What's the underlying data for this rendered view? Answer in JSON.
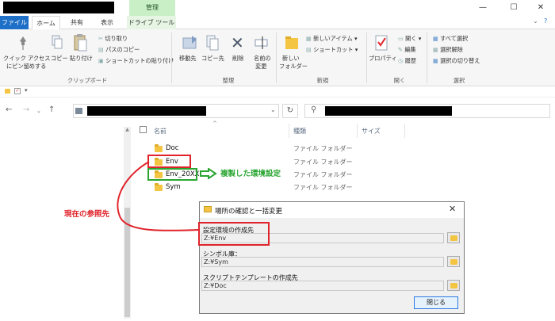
{
  "window": {
    "manage_tab": "管理",
    "minimize": "—",
    "maximize": "☐",
    "close": "✕"
  },
  "tabs": [
    "ファイル",
    "ホーム",
    "共有",
    "表示",
    "ドライブ ツール"
  ],
  "ribbon": {
    "pin_label_1": "クイック アクセス",
    "pin_label_2": "にピン留めする",
    "copy": "コピー",
    "paste": "貼り付け",
    "cut": "切り取り",
    "copy_path": "パスのコピー",
    "paste_shortcut": "ショートカットの貼り付け",
    "clipboard_group": "クリップボード",
    "move_to": "移動先",
    "copy_to": "コピー先",
    "delete": "削除",
    "rename_1": "名前の",
    "rename_2": "変更",
    "organize_group": "整理",
    "new_folder_1": "新しい",
    "new_folder_2": "フォルダー",
    "new_item": "新しいアイテム ▾",
    "shortcut": "ショートカット ▾",
    "new_group": "新規",
    "properties": "プロパティ",
    "open": "開く ▾",
    "edit": "編集",
    "history": "履歴",
    "open_group": "開く",
    "select_all": "すべて選択",
    "select_none": "選択解除",
    "invert_selection": "選択の切り替え",
    "select_group": "選択"
  },
  "address": {
    "refresh": "↻",
    "search_icon": "⚲"
  },
  "file_list": {
    "header_name": "名前",
    "header_type": "種類",
    "header_size": "サイズ",
    "rows": [
      {
        "name": "Doc",
        "type": "ファイル フォルダー"
      },
      {
        "name": "Env",
        "type": "ファイル フォルダー"
      },
      {
        "name": "Env_20XX",
        "type": "ファイル フォルダー"
      },
      {
        "name": "Sym",
        "type": "ファイル フォルダー"
      }
    ]
  },
  "annotations": {
    "current_reference": "現在の参照先",
    "copied_env": "複製した環境設定"
  },
  "dialog": {
    "title": "場所の確認と一括変更",
    "env_label": "設定環境の作成先",
    "env_value": "Z:¥Env",
    "sym_label": "シンボル庫：",
    "sym_value": "Z:¥Sym",
    "template_label": "スクリプトテンプレートの作成先",
    "template_value": "Z:¥Doc",
    "close_button": "閉じる"
  }
}
